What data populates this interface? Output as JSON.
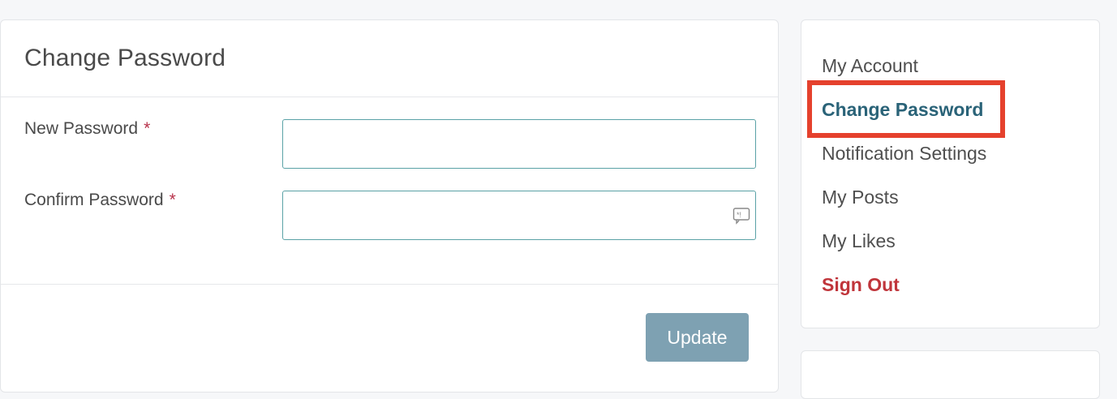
{
  "form": {
    "title": "Change Password",
    "new_password_label": "New Password",
    "confirm_password_label": "Confirm Password",
    "required_marker": "*",
    "new_password_value": "",
    "confirm_password_value": "",
    "update_label": "Update"
  },
  "sidebar": {
    "items": [
      {
        "label": "My Account"
      },
      {
        "label": "Change Password"
      },
      {
        "label": "Notification Settings"
      },
      {
        "label": "My Posts"
      },
      {
        "label": "My Likes"
      },
      {
        "label": "Sign Out"
      }
    ],
    "active_item": "Change Password"
  },
  "colors": {
    "accent": "#2a6378",
    "signout": "#c0353b",
    "button": "#7ea1b2",
    "highlight": "#e5412d",
    "input_border": "#5aa2a6"
  }
}
